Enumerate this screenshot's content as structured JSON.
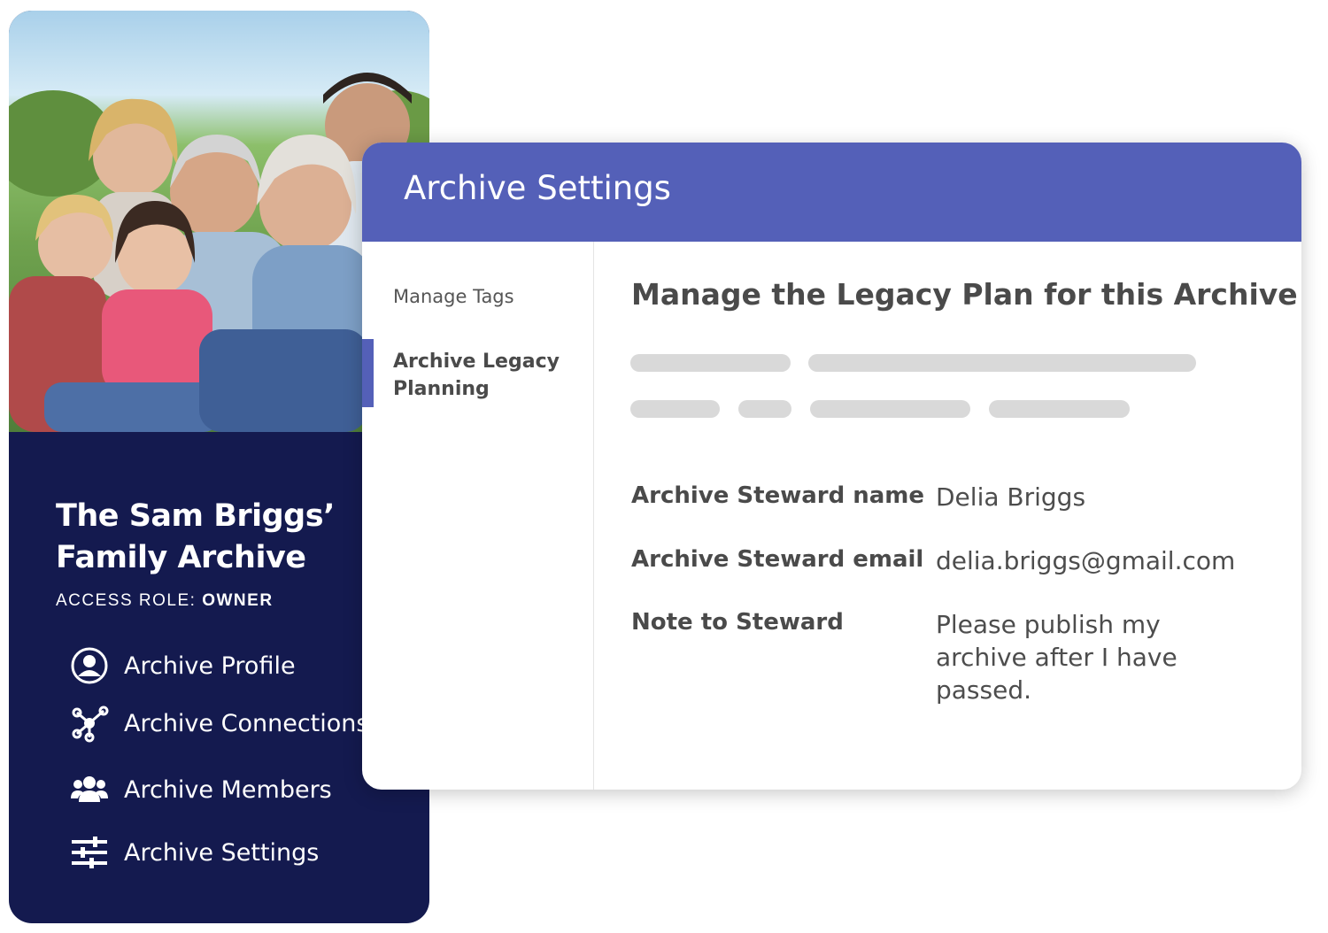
{
  "archive_card": {
    "photo_alt": "family-photo",
    "title": "The Sam Briggs’ Family Archive",
    "access_role_label": "ACCESS ROLE: ",
    "access_role_value": "OWNER",
    "nav_items": [
      {
        "label": "Archive Profile",
        "icon": "user-circle-icon"
      },
      {
        "label": "Archive Connections",
        "icon": "network-icon"
      },
      {
        "label": "Archive Members",
        "icon": "members-icon"
      },
      {
        "label": "Archive Settings",
        "icon": "sliders-icon"
      }
    ]
  },
  "settings_panel": {
    "title": "Archive Settings",
    "sidebar": {
      "items": [
        {
          "label": "Manage Tags",
          "active": false
        },
        {
          "label": "Archive Legacy Planning",
          "active": true
        }
      ]
    },
    "main": {
      "heading": "Manage the Legacy Plan for this Archive",
      "fields": [
        {
          "label": "Archive Steward name",
          "value": "Delia Briggs"
        },
        {
          "label": "Archive Steward email",
          "value": "delia.briggs@gmail.com"
        },
        {
          "label": "Note to Steward",
          "value": "Please publish my archive after I have passed."
        }
      ]
    }
  },
  "colors": {
    "card_navy": "#141a4f",
    "header_blue": "#5460b8",
    "skeleton_gray": "#d9d9d9",
    "text_dark": "#4a4a4a"
  }
}
